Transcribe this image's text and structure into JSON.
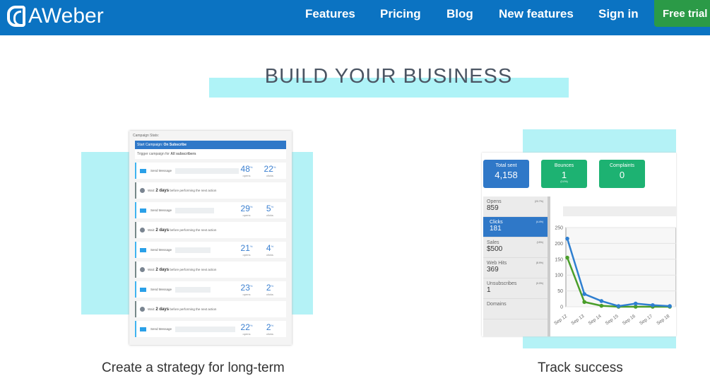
{
  "header": {
    "logo": "AWeber",
    "nav": [
      "Features",
      "Pricing",
      "Blog",
      "New features",
      "Sign in"
    ],
    "cta": "Free trial",
    "brand_color": "#0b73c2",
    "cta_color": "#2b9a47"
  },
  "hero": {
    "title": "BUILD YOUR BUSINESS"
  },
  "campaign": {
    "heading": "Campaign Stats:",
    "start_label": "Start Campaign:",
    "start_value": "On Subscribe",
    "trigger_prefix": "Trigger campaign for",
    "trigger_value": "All subscribers",
    "rows": [
      {
        "type": "send",
        "label": "Send Message",
        "opens": "48",
        "clicks": "22"
      },
      {
        "type": "wait",
        "label": "Wait:",
        "days": "2 days",
        "suffix": "before performing the next action"
      },
      {
        "type": "send",
        "label": "Send Message",
        "opens": "29",
        "clicks": "5"
      },
      {
        "type": "wait",
        "label": "Wait:",
        "days": "2 days",
        "suffix": "before performing the next action"
      },
      {
        "type": "send",
        "label": "Send Message",
        "opens": "21",
        "clicks": "4"
      },
      {
        "type": "wait",
        "label": "Wait:",
        "days": "2 days",
        "suffix": "before performing the next action"
      },
      {
        "type": "send",
        "label": "Send Message",
        "opens": "23",
        "clicks": "2"
      },
      {
        "type": "wait",
        "label": "Wait:",
        "days": "2 days",
        "suffix": "before performing the next action"
      },
      {
        "type": "send",
        "label": "Send Message",
        "opens": "22",
        "clicks": "2"
      }
    ],
    "opens_label": "opens",
    "clicks_label": "clicks",
    "pct": "%"
  },
  "dashboard": {
    "kpis": [
      {
        "label": "Total sent",
        "value": "4,158",
        "sub": "",
        "color": "#2f78c8"
      },
      {
        "label": "Bounces",
        "value": "1",
        "sub": "(0.0%)",
        "color": "#1db272"
      },
      {
        "label": "Complaints",
        "value": "0",
        "sub": "",
        "color": "#1db272"
      }
    ],
    "side": [
      {
        "label": "Opens",
        "value": "859",
        "pct": "(20.7%)"
      },
      {
        "label": "Clicks",
        "value": "181",
        "pct": "(4.4%)",
        "active": true
      },
      {
        "label": "Sales",
        "value": "$500",
        "pct": "(15%)"
      },
      {
        "label": "Web Hits",
        "value": "369",
        "pct": "(8.9%)"
      },
      {
        "label": "Unsubscribes",
        "value": "1",
        "pct": "(0.0%)"
      },
      {
        "label": "Domains",
        "value": "",
        "pct": ""
      }
    ]
  },
  "chart_data": {
    "type": "line",
    "x": [
      "Sep 12",
      "Sep 13",
      "Sep 14",
      "Sep 15",
      "Sep 16",
      "Sep 17",
      "Sep 18"
    ],
    "ylim": [
      0,
      250
    ],
    "yticks": [
      0,
      50,
      100,
      150,
      200,
      250
    ],
    "grid": true,
    "series": [
      {
        "color": "#2f7fd0",
        "values": [
          215,
          40,
          18,
          2,
          10,
          5,
          2
        ]
      },
      {
        "color": "#4a9e2a",
        "values": [
          155,
          15,
          3,
          0,
          0,
          0,
          0
        ]
      }
    ]
  },
  "captions": {
    "left": "Create a strategy for long-term",
    "right": "Track success"
  }
}
